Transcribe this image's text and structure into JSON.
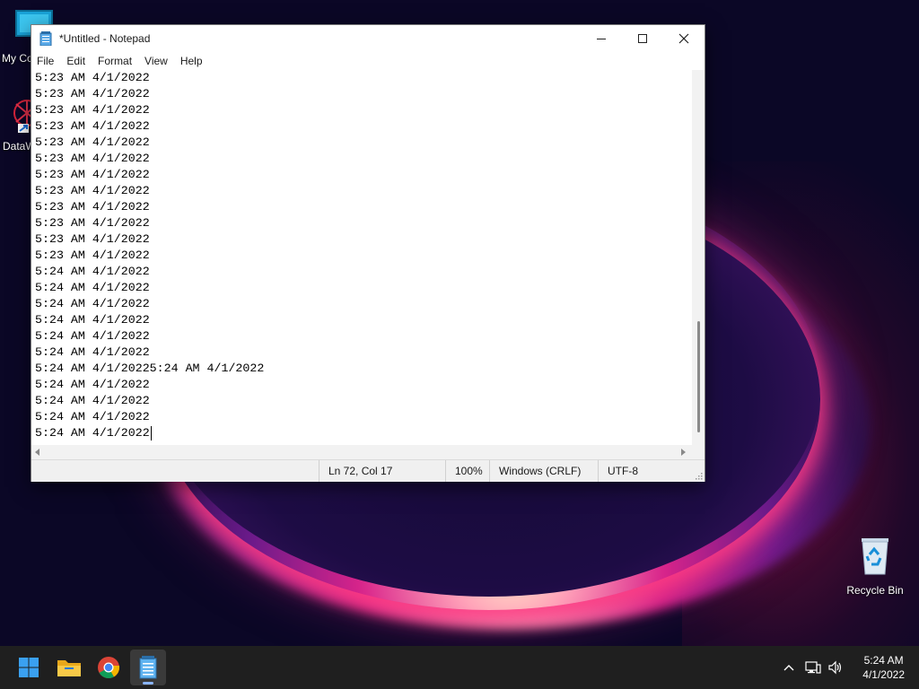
{
  "desktop": {
    "icons": [
      {
        "label": "My Co"
      },
      {
        "label": "DataW"
      },
      {
        "label": "Recycle Bin"
      }
    ]
  },
  "window": {
    "title": "*Untitled - Notepad",
    "menu": [
      "File",
      "Edit",
      "Format",
      "View",
      "Help"
    ],
    "lines": [
      "5:23 AM 4/1/2022",
      "5:23 AM 4/1/2022",
      "5:23 AM 4/1/2022",
      "5:23 AM 4/1/2022",
      "5:23 AM 4/1/2022",
      "5:23 AM 4/1/2022",
      "5:23 AM 4/1/2022",
      "5:23 AM 4/1/2022",
      "5:23 AM 4/1/2022",
      "5:23 AM 4/1/2022",
      "5:23 AM 4/1/2022",
      "5:23 AM 4/1/2022",
      "5:24 AM 4/1/2022",
      "5:24 AM 4/1/2022",
      "5:24 AM 4/1/2022",
      "5:24 AM 4/1/2022",
      "5:24 AM 4/1/2022",
      "5:24 AM 4/1/2022",
      "5:24 AM 4/1/20225:24 AM 4/1/2022",
      "5:24 AM 4/1/2022",
      "5:24 AM 4/1/2022",
      "5:24 AM 4/1/2022",
      "5:24 AM 4/1/2022"
    ],
    "status": {
      "position": "Ln 72, Col 17",
      "zoom": "100%",
      "line_ending": "Windows (CRLF)",
      "encoding": "UTF-8"
    }
  },
  "taskbar": {
    "apps": [
      {
        "icon": "windows-start-icon"
      },
      {
        "icon": "file-explorer-icon"
      },
      {
        "icon": "chrome-icon"
      },
      {
        "icon": "notepad-icon",
        "active": true
      }
    ],
    "tray": [
      "chevron-up-icon",
      "network-icon",
      "volume-icon"
    ],
    "clock": {
      "time": "5:24 AM",
      "date": "4/1/2022"
    }
  },
  "colors": {
    "taskbar": "#1f1f1f",
    "accent": "#8ab4f8",
    "status_bar": "#f0f0f0"
  }
}
